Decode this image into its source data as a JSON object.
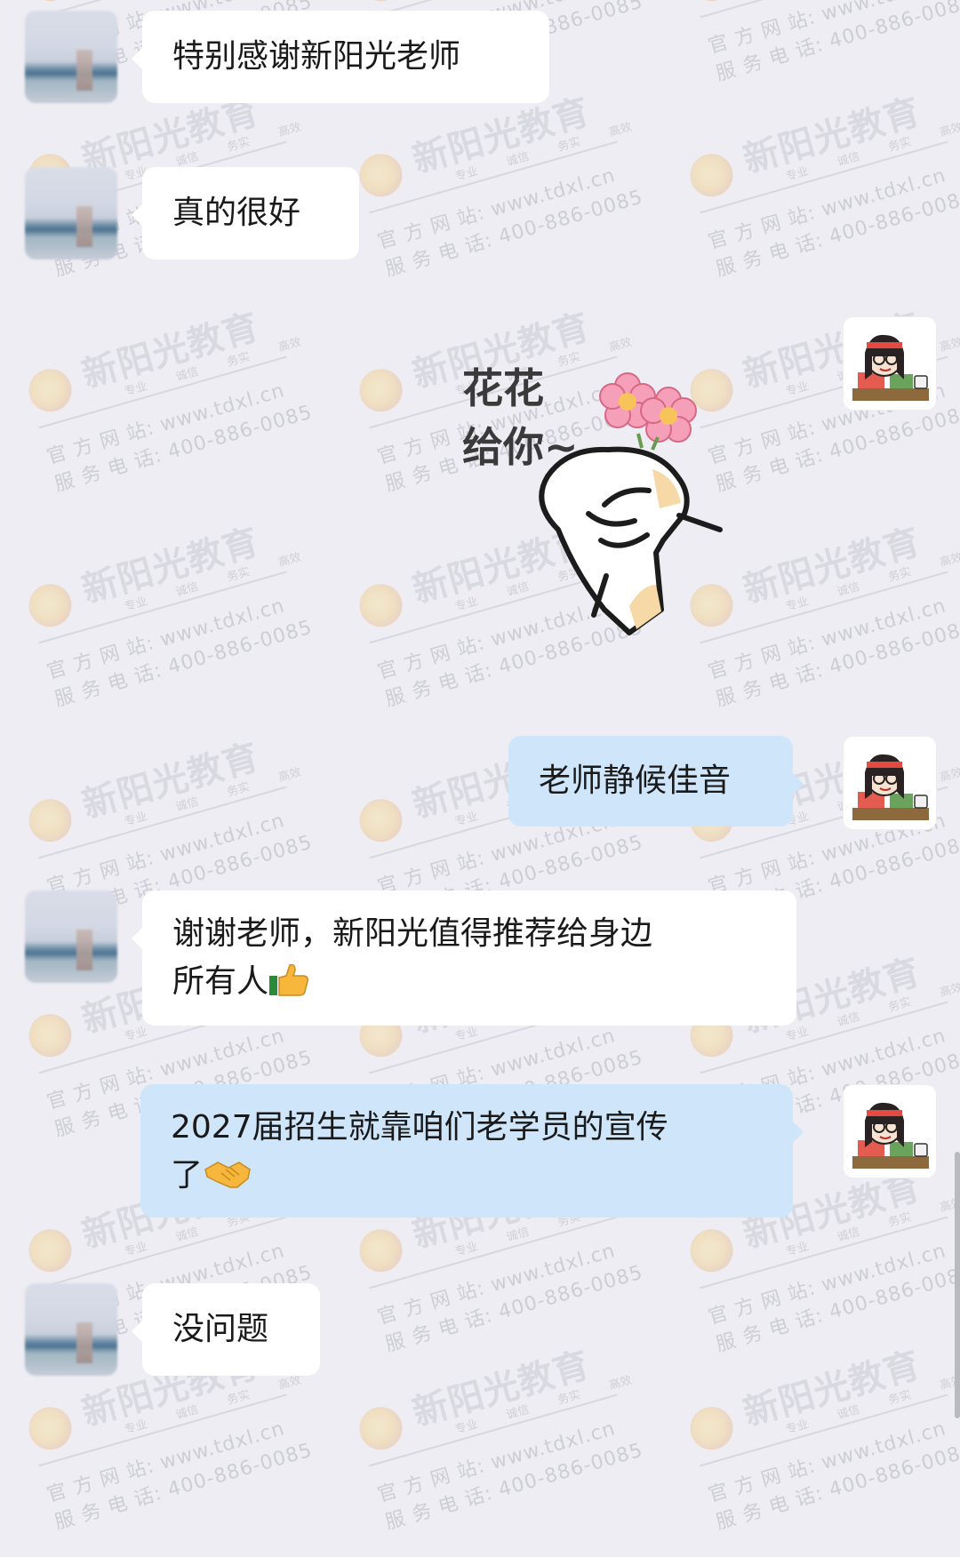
{
  "watermark": {
    "brand": "新阳光教育",
    "tags": [
      "专业",
      "诚信",
      "务实",
      "高效"
    ],
    "site": "官 方 网 站: www.tdxl.cn",
    "phone": "服 务 电 话: 400-886-0085"
  },
  "messages": [
    {
      "sender": "other",
      "text": "特别感谢新阳光老师"
    },
    {
      "sender": "other",
      "text": "真的很好"
    },
    {
      "sender": "me",
      "sticker": "flower-sticker",
      "sticker_text": "花花\n给你~"
    },
    {
      "sender": "me",
      "text": "老师静候佳音"
    },
    {
      "sender": "other",
      "text_line1": "谢谢老师，新阳光值得推荐给身边",
      "text_line2": "所有人",
      "emoji": "thumbs-up-emoji"
    },
    {
      "sender": "me",
      "text_line1": "2027届招生就靠咱们老学员的宣传",
      "text_line2": "了",
      "emoji": "handshake-emoji"
    },
    {
      "sender": "other",
      "text": "没问题"
    }
  ],
  "colors": {
    "background": "#EDEDF3",
    "bubble_other": "#FFFFFF",
    "bubble_me": "#CFE6FA",
    "text": "#1A1A1A"
  }
}
